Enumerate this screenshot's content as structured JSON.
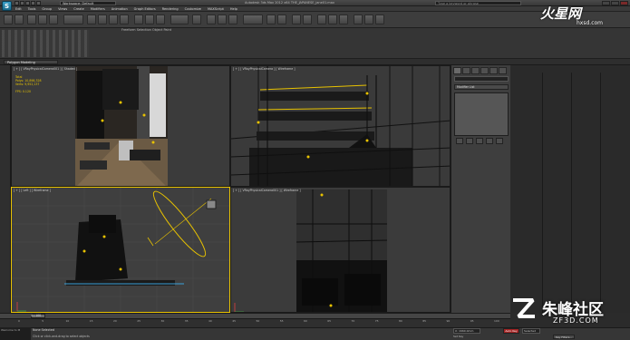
{
  "title_bar": {
    "logo": "S",
    "workspace": "Workspace: Default",
    "window_title": "Autodesk 3ds Max 2012 x64    THE_JAPANESE_jane01.max",
    "search_placeholder": "Type a keyword or phrase"
  },
  "menu": [
    "Edit",
    "Tools",
    "Group",
    "Views",
    "Create",
    "Modifiers",
    "Animation",
    "Graph Editors",
    "Rendering",
    "Customize",
    "MAXScript",
    "Help"
  ],
  "ribbon": {
    "freeform_label": "Freeform  Selection  Object Paint",
    "polygon_modeling": "Polygon Modeling"
  },
  "viewports": {
    "top_left": {
      "label": "[ + ] [ VRayPhysicalCamera001 ] [ Shaded ]",
      "stats": {
        "total": "Total",
        "polys_label": "Polys:",
        "polys_value": "10,898,328",
        "verts_label": "Verts:",
        "verts_value": "9,952,137",
        "fps_label": "FPS:",
        "fps_value": "0.120"
      }
    },
    "top_right": {
      "label": "[ + ] [ VRayPhysicalCamera ] [ Wireframe ]"
    },
    "bottom_left": {
      "label": "[ + ] [ Left ] [ Wireframe ]"
    },
    "bottom_right": {
      "label": "[ + ] [ VRayPhysicalCamera001 ] [ Wireframe ]"
    }
  },
  "command_panel": {
    "modifier_list": "Modifier List"
  },
  "timeline": {
    "slider_label": "0 / 100",
    "ticks": [
      "0",
      "5",
      "10",
      "15",
      "20",
      "25",
      "30",
      "35",
      "40",
      "45",
      "50",
      "55",
      "60",
      "65",
      "70",
      "75",
      "80",
      "85",
      "90",
      "95",
      "100"
    ]
  },
  "status": {
    "maxscript": "Welcome to M",
    "selection": "None Selected",
    "prompt": "Click or click-and-drag to select objects",
    "coord_x": "X: 1660.0mm",
    "auto_key": "Auto Key",
    "selected": "Selected",
    "set_key": "Set Key",
    "key_filters": "Key Filters..."
  },
  "watermarks": {
    "top": "火星网",
    "top_sub": "hxsd.com",
    "bottom": "朱峰社区",
    "bottom_sub": "ZF3D.COM"
  },
  "colors": {
    "accent": "#e8c200",
    "auto_key": "#a32323",
    "viewport_bg": "#3b3b3b"
  }
}
